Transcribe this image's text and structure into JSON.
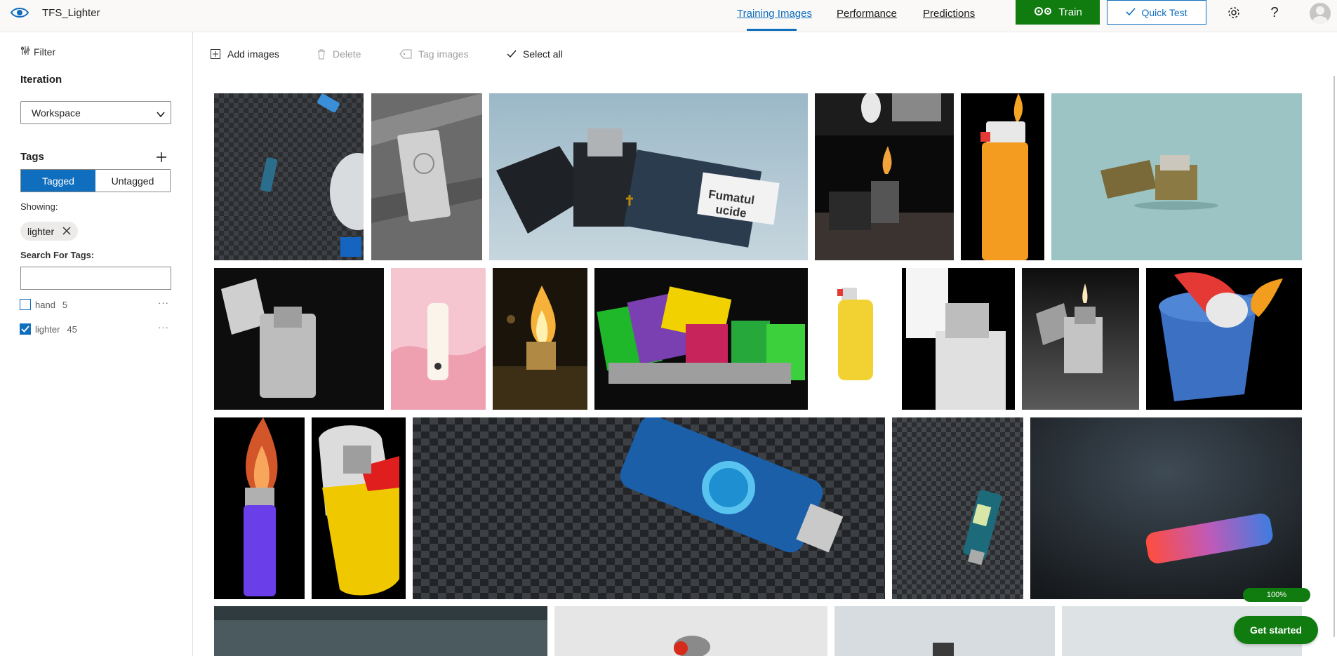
{
  "app": {
    "project_name": "TFS_Lighter"
  },
  "nav": {
    "training_images": "Training Images",
    "performance": "Performance",
    "predictions": "Predictions"
  },
  "actions": {
    "train": "Train",
    "quick_test": "Quick Test"
  },
  "icons": {
    "settings": "gear-icon",
    "help": "?"
  },
  "sidebar": {
    "filter": "Filter",
    "iteration_label": "Iteration",
    "iteration_value": "Workspace",
    "tags_label": "Tags",
    "tagged": "Tagged",
    "untagged": "Untagged",
    "showing_label": "Showing:",
    "showing_chip": "lighter",
    "search_label": "Search For Tags:",
    "search_value": "",
    "tags": [
      {
        "name": "hand",
        "count": "5",
        "checked": false
      },
      {
        "name": "lighter",
        "count": "45",
        "checked": true
      }
    ]
  },
  "toolbar": {
    "add_images": "Add images",
    "delete": "Delete",
    "tag_images": "Tag images",
    "select_all": "Select all"
  },
  "thumb_text": {
    "fumatul": "Fumatul",
    "ucide": "ucide"
  },
  "status": {
    "progress": "100%",
    "get_started": "Get started"
  },
  "colors": {
    "accent": "#106ebe",
    "train_green": "#107c10"
  }
}
